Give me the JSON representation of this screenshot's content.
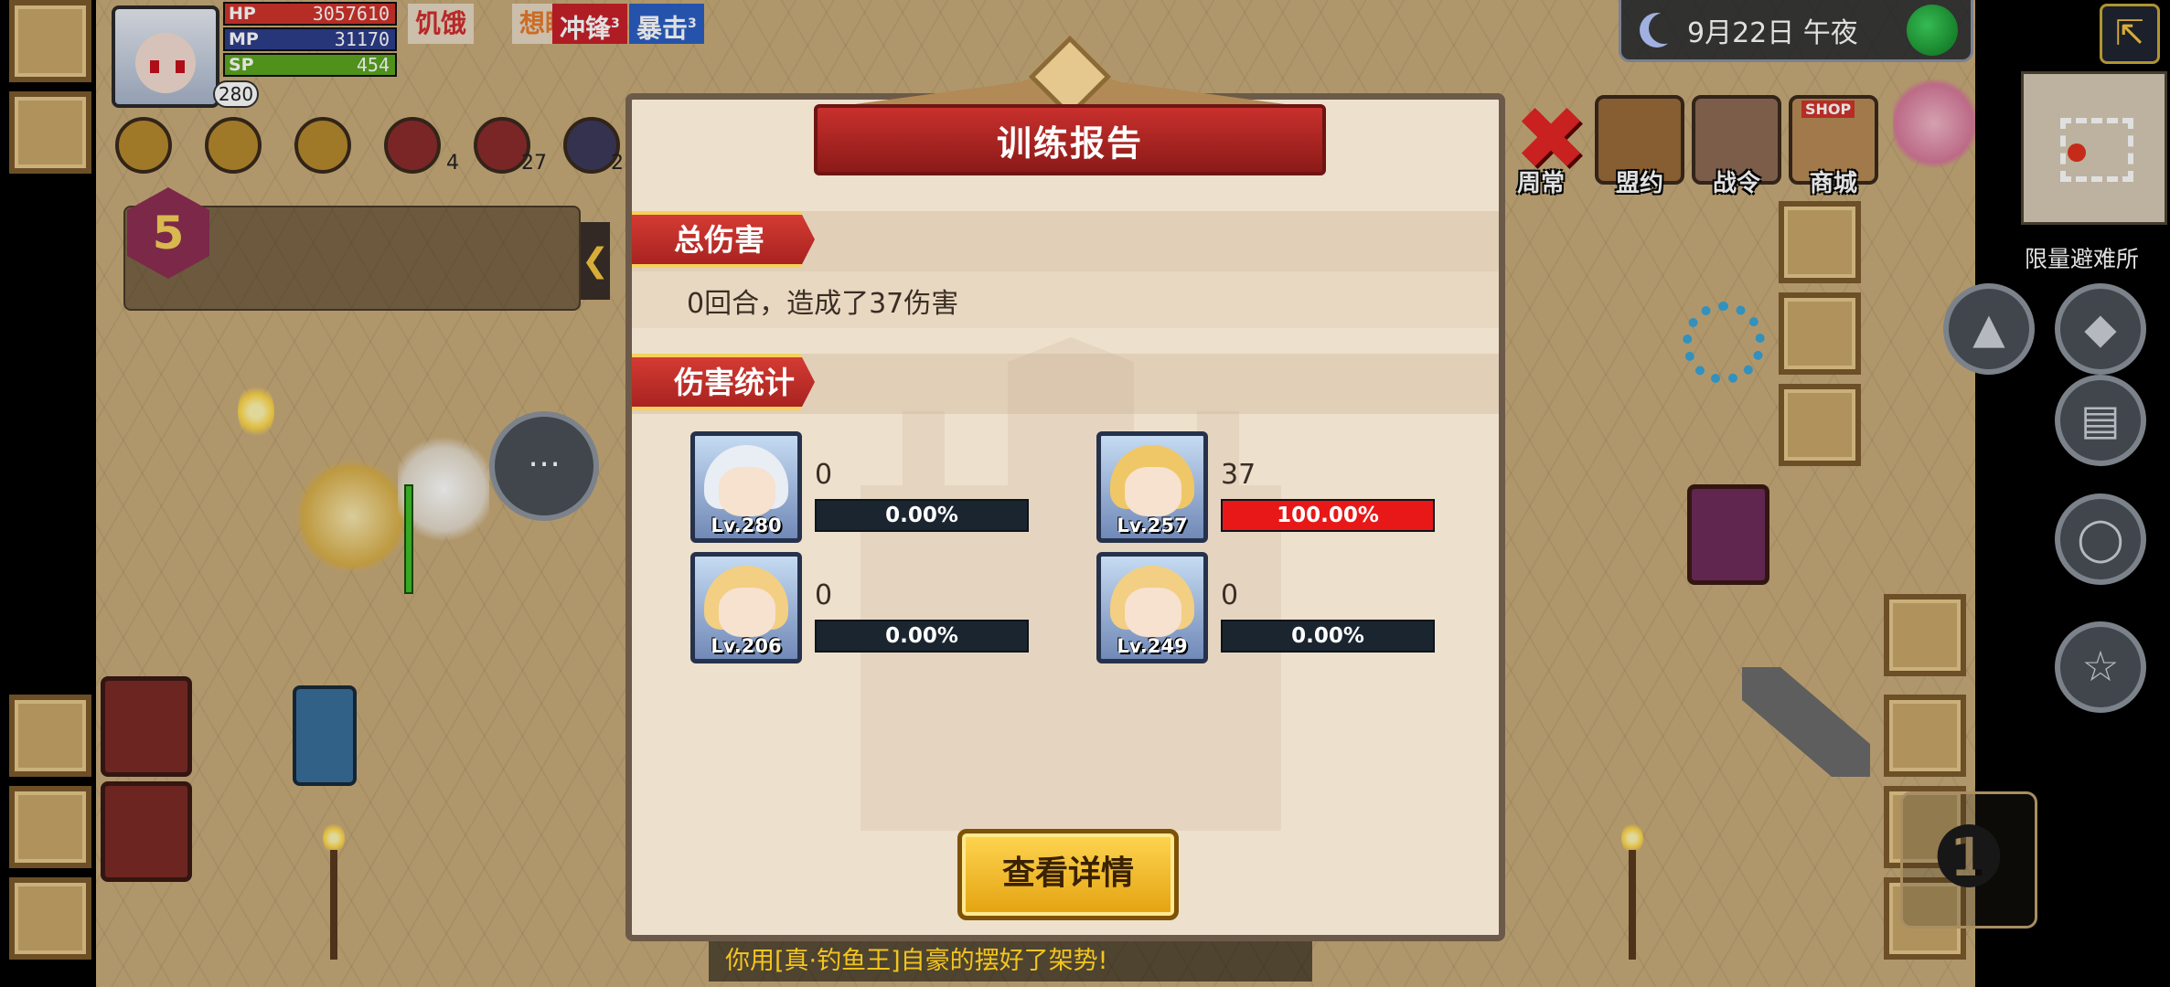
{
  "player": {
    "hp_label": "HP",
    "hp_value": "3057610",
    "mp_label": "MP",
    "mp_value": "31170",
    "sp_label": "SP",
    "sp_value": "454",
    "level": "280",
    "combat_level": "5"
  },
  "status_effects": [
    {
      "label": "饥饿",
      "stack": ""
    },
    {
      "label": "想睡",
      "stack": ""
    },
    {
      "label": "冲锋",
      "stack": "3"
    },
    {
      "label": "暴击",
      "stack": "3"
    }
  ],
  "skill_counts": [
    "4",
    "27",
    "2"
  ],
  "clock": {
    "date_time": "9月22日 午夜"
  },
  "top_menu": [
    {
      "label": "周常",
      "icon": "close-icon"
    },
    {
      "label": "盟约",
      "icon": "pentagram-icon"
    },
    {
      "label": "战令",
      "icon": "dragon-icon"
    },
    {
      "label": "商城",
      "icon": "shop-icon",
      "sign": "SHOP"
    }
  ],
  "side": {
    "shelter_label": "限量避难所"
  },
  "dialog": {
    "title": "训练报告",
    "total_section": "总伤害",
    "total_text": "0回合，造成了37伤害",
    "stats_section": "伤害统计",
    "details_button": "查看详情"
  },
  "damage_stats": [
    {
      "level": "Lv.280",
      "damage": "0",
      "percent": "0.00%",
      "fraction": 0.0
    },
    {
      "level": "Lv.257",
      "damage": "37",
      "percent": "100.00%",
      "fraction": 1.0
    },
    {
      "level": "Lv.206",
      "damage": "0",
      "percent": "0.00%",
      "fraction": 0.0
    },
    {
      "level": "Lv.249",
      "damage": "0",
      "percent": "0.00%",
      "fraction": 0.0
    }
  ],
  "combat_log": "你用[真·钓鱼王]自豪的摆好了架势!",
  "colors": {
    "hp": "#d0342c",
    "mp": "#2d3d8a",
    "sp": "#5aa51f",
    "accent_red": "#c8302d",
    "gold": "#f5c541"
  }
}
